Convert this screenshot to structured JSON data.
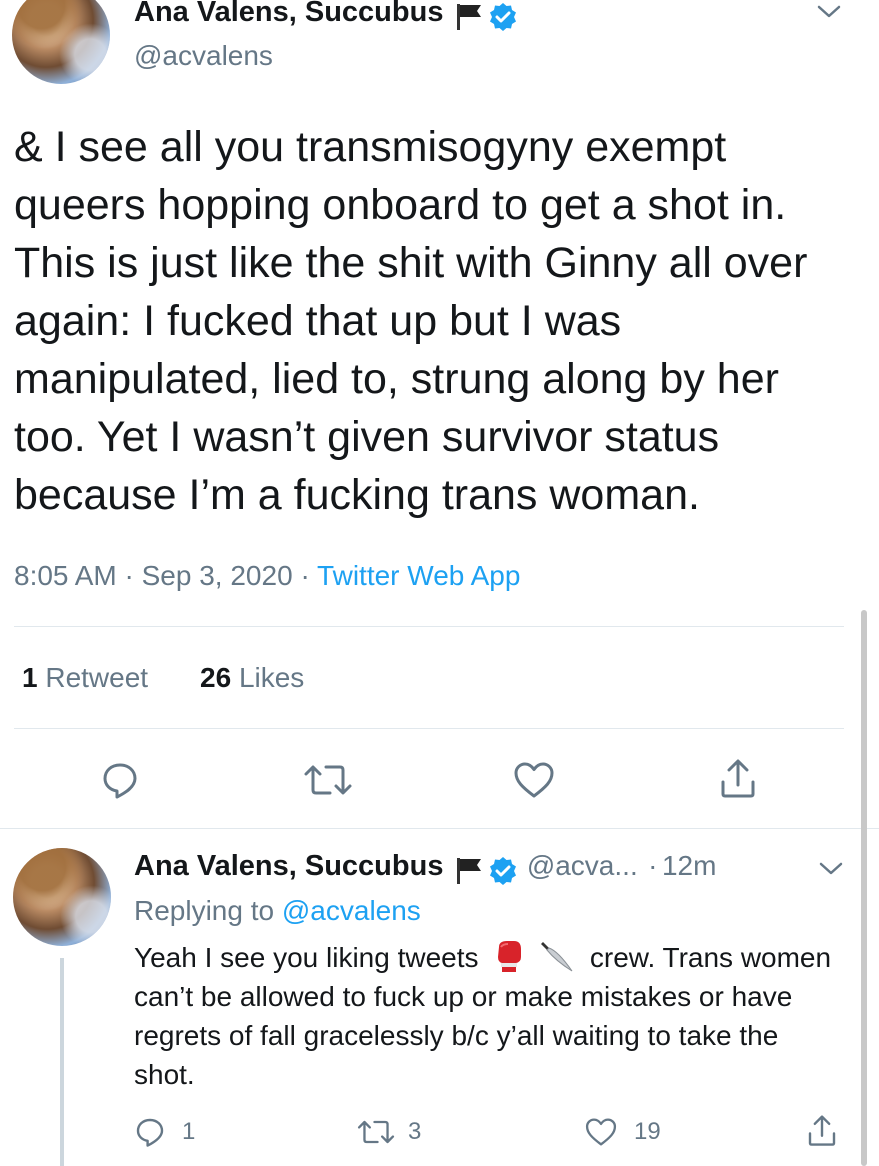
{
  "tweet": {
    "author_name": "Ana Valens, Succubus",
    "author_handle": "@acvalens",
    "text": "& I see all you transmisogyny exempt queers hopping onboard to get a shot in. This is just like the shit with Ginny all over again: I fucked that up but I was manipulated, lied to, strung along by her too. Yet I wasn’t given survivor status because I’m a fucking trans woman.",
    "time": "8:05 AM",
    "date": "Sep 3, 2020",
    "source": "Twitter Web App",
    "separator": "·",
    "retweets_count": "1",
    "retweets_label": "Retweet",
    "likes_count": "26",
    "likes_label": "Likes"
  },
  "reply": {
    "author_name": "Ana Valens, Succubus",
    "author_handle": "@acva...",
    "separator": "·",
    "age": "12m",
    "replying_prefix": "Replying to",
    "replying_handle": "@acvalens",
    "text_before_emoji": "Yeah I see you liking tweets",
    "text_after_emoji": "crew. Trans women can’t be allowed to fuck up or make mistakes or have regrets of fall gracelessly b/c y’all waiting to take the shot.",
    "emoji": [
      "boxing-glove",
      "knife"
    ],
    "reply_count": "1",
    "retweet_count": "3",
    "like_count": "19"
  },
  "colors": {
    "text": "#14171a",
    "secondary": "#657786",
    "accent": "#1da1f2",
    "divider": "#e1e8ed",
    "verified": "#1da1f2"
  },
  "icons": {
    "main_actions": [
      "reply-icon",
      "retweet-icon",
      "like-icon",
      "share-icon"
    ],
    "caret": "chevron-down-icon",
    "flag": "black-flag-icon",
    "verified": "verified-badge-icon"
  }
}
